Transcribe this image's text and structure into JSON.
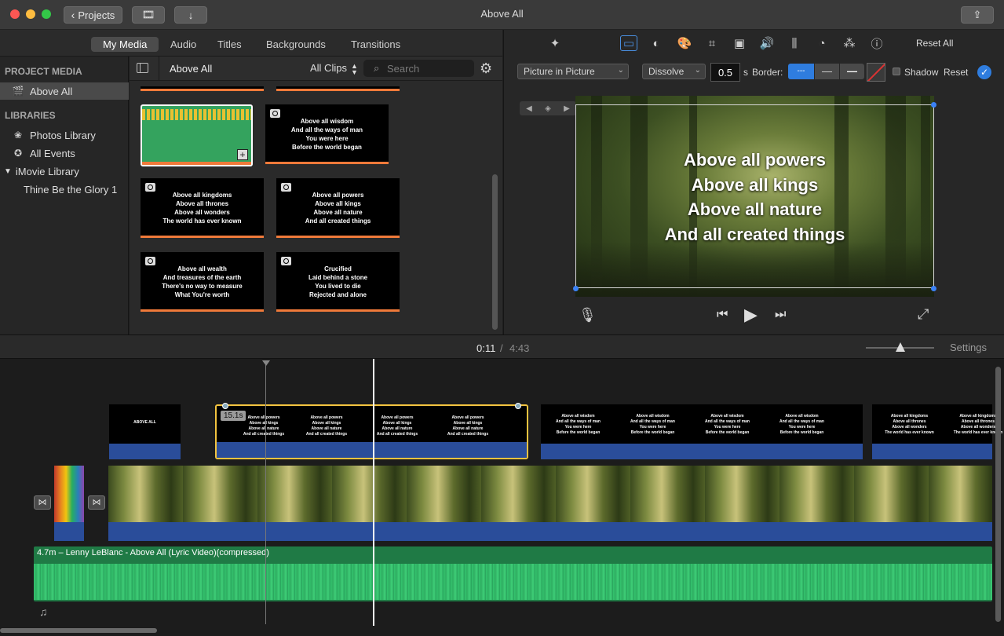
{
  "window": {
    "title": "Above All"
  },
  "toolbar": {
    "projects_label": "Projects"
  },
  "tabs": [
    "My Media",
    "Audio",
    "Titles",
    "Backgrounds",
    "Transitions"
  ],
  "sidebar": {
    "project_media_header": "PROJECT MEDIA",
    "project_item": "Above All",
    "libraries_header": "LIBRARIES",
    "libraries": [
      "Photos Library",
      "All Events",
      "iMovie Library"
    ],
    "event": "Thine Be the Glory 1"
  },
  "browser": {
    "project_name": "Above All",
    "filter": "All Clips",
    "search_placeholder": "Search",
    "thumbnails": [
      {
        "text": ""
      },
      {
        "text": "Above all wisdom\nAnd all the ways of man\nYou were here\nBefore the world began"
      },
      {
        "text": "Above all kingdoms\nAbove all thrones\nAbove all wonders\nThe world has ever known"
      },
      {
        "text": "Above all powers\nAbove all kings\nAbove all nature\nAnd all created things"
      },
      {
        "text": "Above all wealth\nAnd treasures of the earth\nThere's no way to measure\nWhat You're worth"
      },
      {
        "text": "Crucified\nLaid behind a stone\nYou lived to die\nRejected and alone"
      }
    ]
  },
  "viewer": {
    "reset_all": "Reset All",
    "overlay_mode": "Picture in Picture",
    "transition": "Dissolve",
    "duration": "0.5",
    "duration_unit": "s",
    "border_label": "Border:",
    "shadow_label": "Shadow",
    "reset_label": "Reset",
    "lyrics": [
      "Above all powers",
      "Above all kings",
      "Above all nature",
      "And all created things"
    ]
  },
  "timebar": {
    "current": "0:11",
    "separator": "/",
    "total": "4:43",
    "settings_label": "Settings"
  },
  "timeline": {
    "clip_duration_badge": "15.1s",
    "first_clip_text": "ABOVE ALL",
    "clip_texts": [
      "Above all powers\nAbove all kings\nAbove all nature\nAnd all created things",
      "Above all wisdom\nAnd all the ways of man\nYou were here\nBefore the world began",
      "Above all kingdoms\nAbove all thrones\nAbove all wonders\nThe world has ever known"
    ],
    "audio_label": "4.7m – Lenny LeBlanc - Above All (Lyric Video)(compressed)"
  }
}
